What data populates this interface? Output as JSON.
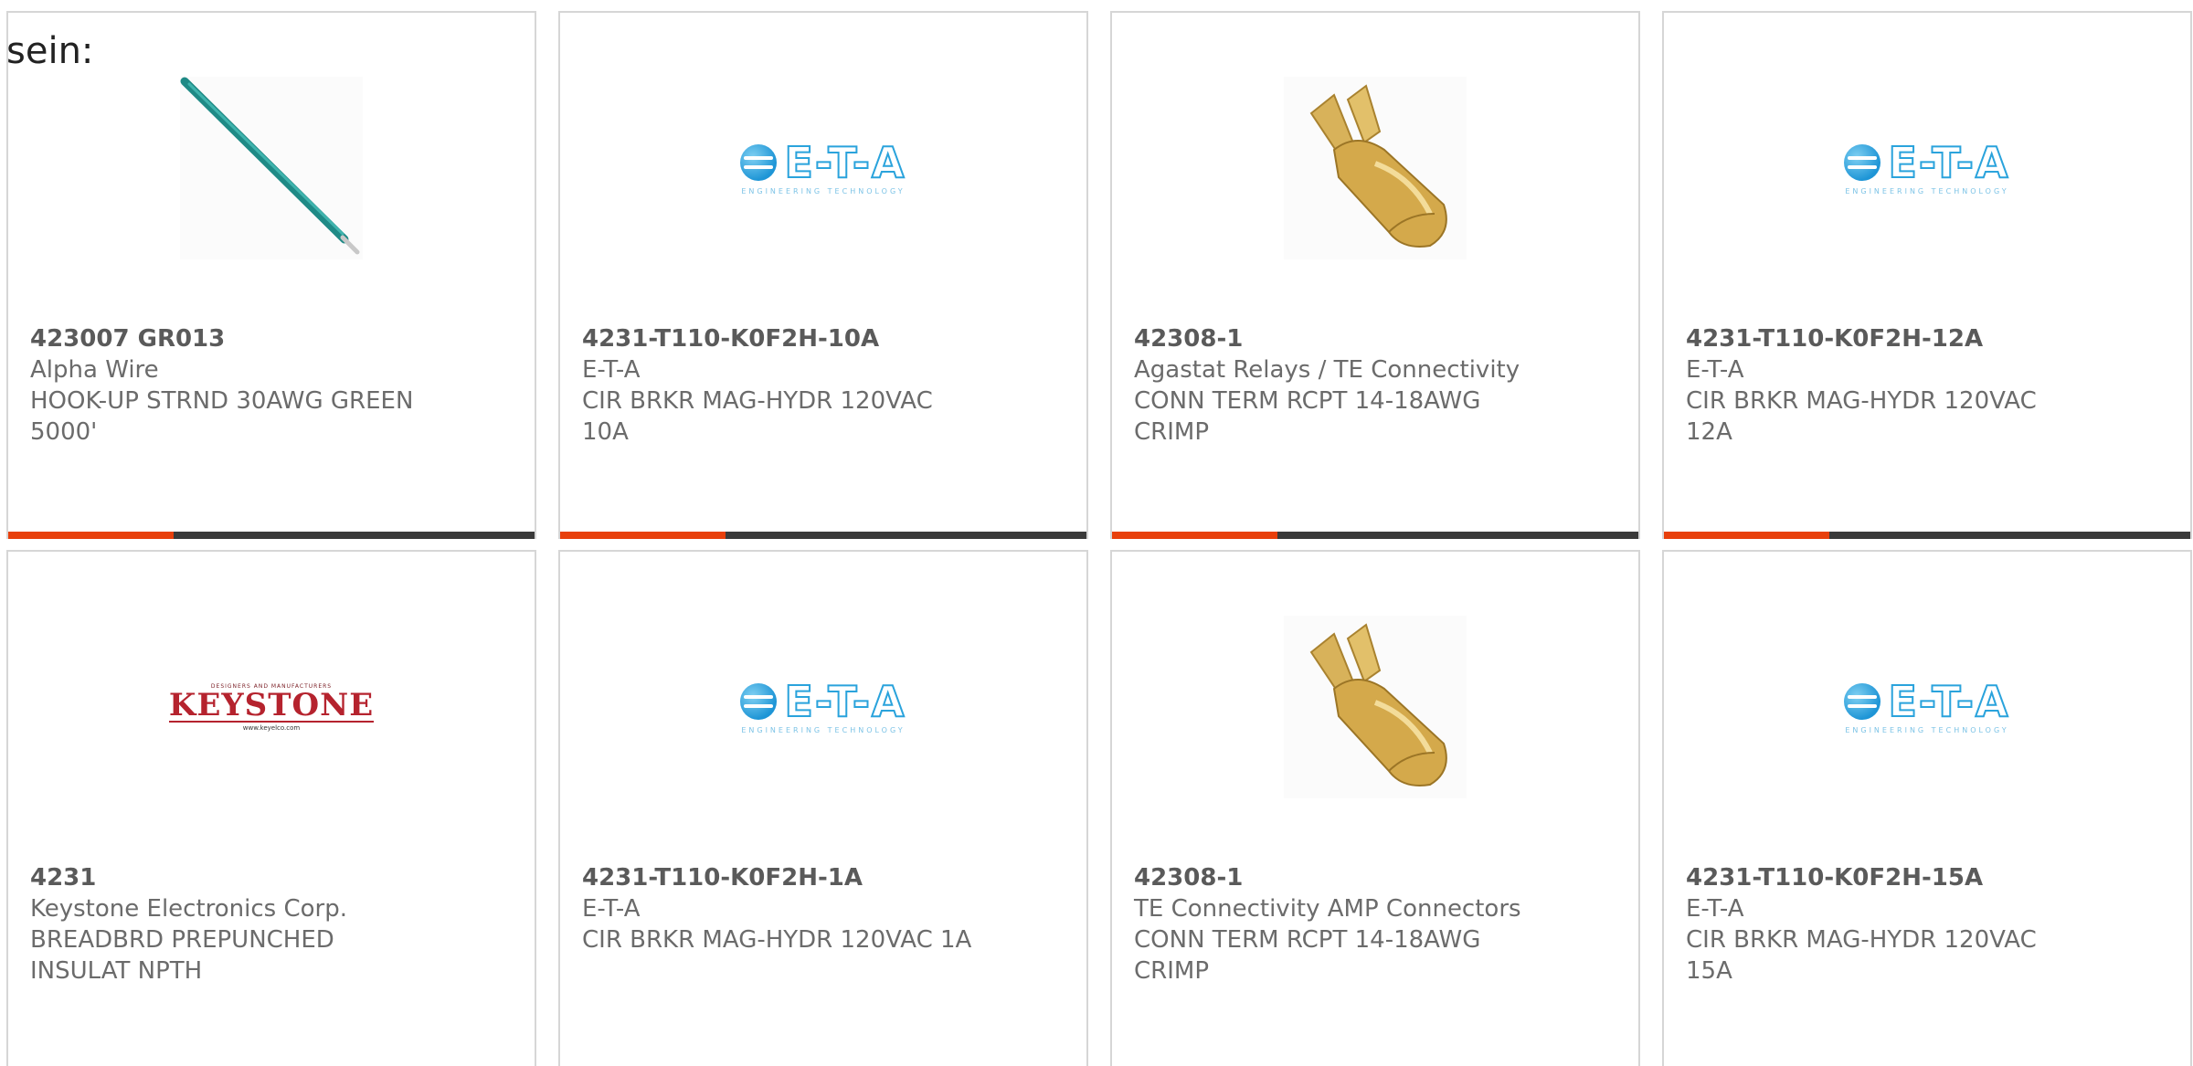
{
  "lead_text": "sein:",
  "colors": {
    "accent": "#e8400c",
    "bar": "#3a3a3a",
    "border": "#d6d6d6"
  },
  "products": [
    {
      "part_number": "423007 GR013",
      "manufacturer": "Alpha Wire",
      "description": "HOOK-UP STRND 30AWG GREEN 5000'",
      "image": "green-wire-image"
    },
    {
      "part_number": "4231-T110-K0F2H-10A",
      "manufacturer": "E-T-A",
      "description": "CIR BRKR MAG-HYDR 120VAC 10A",
      "image": "eta-logo",
      "logo_text": "E-T-A",
      "logo_sub": "ENGINEERING TECHNOLOGY"
    },
    {
      "part_number": "42308-1",
      "manufacturer": "Agastat Relays / TE Connectivity",
      "description": "CONN TERM RCPT 14-18AWG CRIMP",
      "image": "crimp-terminal-image"
    },
    {
      "part_number": "4231-T110-K0F2H-12A",
      "manufacturer": "E-T-A",
      "description": "CIR BRKR MAG-HYDR 120VAC 12A",
      "image": "eta-logo",
      "logo_text": "E-T-A",
      "logo_sub": "ENGINEERING TECHNOLOGY"
    },
    {
      "part_number": "4231",
      "manufacturer": "Keystone Electronics Corp.",
      "description": "BREADBRD PREPUNCHED INSULAT NPTH",
      "image": "keystone-logo",
      "logo_text": "KEYSTONE",
      "logo_small": "DESIGNERS AND MANUFACTURERS",
      "logo_url": "www.keyelco.com"
    },
    {
      "part_number": "4231-T110-K0F2H-1A",
      "manufacturer": "E-T-A",
      "description": "CIR BRKR MAG-HYDR 120VAC 1A",
      "image": "eta-logo",
      "logo_text": "E-T-A",
      "logo_sub": "ENGINEERING TECHNOLOGY"
    },
    {
      "part_number": "42308-1",
      "manufacturer": "TE Connectivity AMP Connectors",
      "description": "CONN TERM RCPT 14-18AWG CRIMP",
      "image": "crimp-terminal-image"
    },
    {
      "part_number": "4231-T110-K0F2H-15A",
      "manufacturer": "E-T-A",
      "description": "CIR BRKR MAG-HYDR 120VAC 15A",
      "image": "eta-logo",
      "logo_text": "E-T-A",
      "logo_sub": "ENGINEERING TECHNOLOGY"
    }
  ]
}
